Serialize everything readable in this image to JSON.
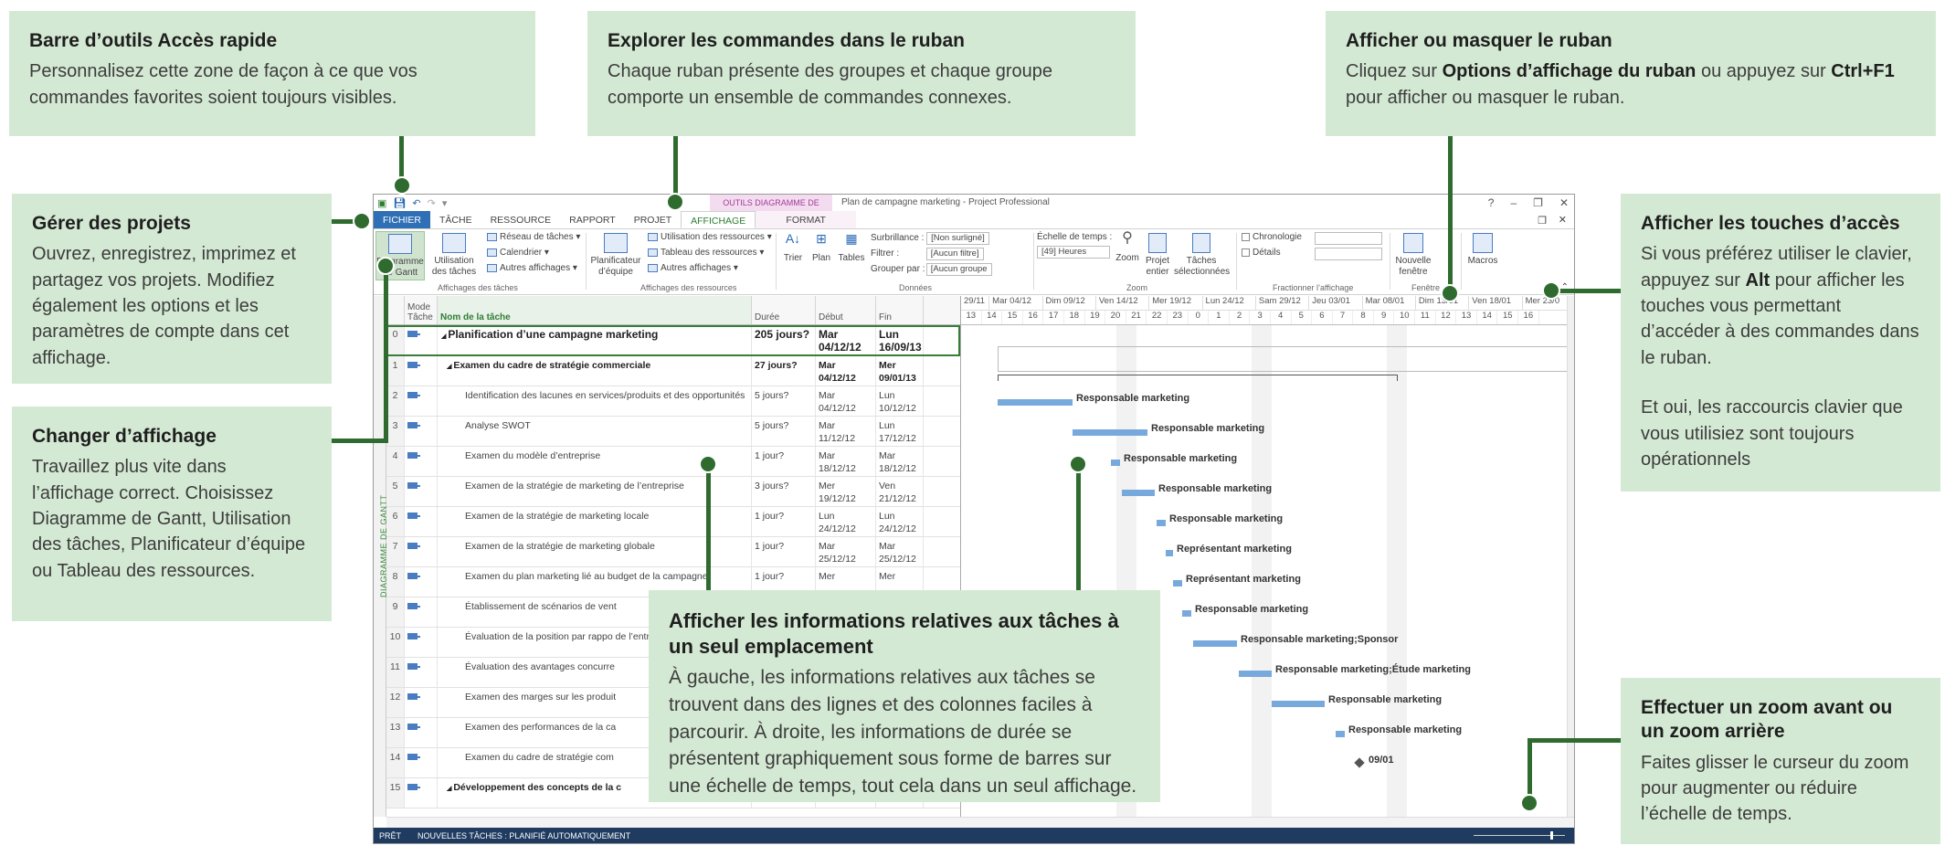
{
  "callouts": {
    "qat": {
      "title": "Barre d’outils Accès rapide",
      "body": "Personnalisez cette zone de façon à ce que vos commandes favorites soient toujours visibles."
    },
    "ribbon": {
      "title": "Explorer les commandes dans le ruban",
      "body": "Chaque ruban présente des groupes et chaque groupe comporte un ensemble de commandes connexes."
    },
    "toggle": {
      "title": "Afficher ou masquer le ruban",
      "body_pre": "Cliquez sur ",
      "body_b1": "Options d’affichage du ruban",
      "body_mid": " ou appuyez sur ",
      "body_b2": "Ctrl+F1",
      "body_post": " pour afficher ou masquer le ruban."
    },
    "manage": {
      "title": "Gérer des projets",
      "body": "Ouvrez, enregistrez, imprimez et partagez vos projets. Modifiez également les options et les paramètres de compte dans cet affichage."
    },
    "views": {
      "title": "Changer d’affichage",
      "body": "Travaillez plus vite dans l’affichage correct. Choisissez Diagramme de Gantt, Utilisation des tâches, Planificateur d’équipe ou Tableau des ressources."
    },
    "keys": {
      "title": "Afficher les touches d’accès",
      "body_pre": "Si vous préférez utiliser le clavier, appuyez sur ",
      "body_b": "Alt",
      "body_post": " pour afficher les touches vous permettant d’accéder à des commandes dans le ruban.",
      "body2": "Et oui, les raccourcis clavier que vous utilisiez sont toujours opérationnels"
    },
    "info": {
      "title": "Afficher les informations relatives aux tâches à un seul emplacement",
      "body": "À gauche, les informations relatives aux tâches se trouvent dans des lignes et des colonnes faciles à parcourir. À droite, les informations de durée se présentent graphiquement sous forme de barres sur une échelle de temps, tout cela dans un seul affichage."
    },
    "zoom": {
      "title": "Effectuer un zoom avant ou un zoom arrière",
      "body": "Faites glisser le curseur du zoom pour augmenter ou réduire l’échelle de temps."
    }
  },
  "app": {
    "context_tab_title": "OUTILS DIAGRAMME DE GANTT",
    "window_title": "Plan de campagne marketing - Project Professional",
    "tabs": [
      "FICHIER",
      "TÂCHE",
      "RESSOURCE",
      "RAPPORT",
      "PROJET",
      "AFFICHAGE",
      "FORMAT"
    ],
    "ribbon": {
      "gantt_btn": "Diagramme de Gantt",
      "task_usage_btn": "Utilisation des tâches",
      "network": "Réseau de tâches",
      "calendar": "Calendrier",
      "other_views": "Autres affichages",
      "group_task_views": "Affichages des tâches",
      "team_planner": "Planificateur d’équipe",
      "resource_usage": "Utilisation des ressources",
      "resource_sheet": "Tableau des ressources",
      "other_views2": "Autres affichages",
      "group_resource_views": "Affichages des ressources",
      "sort": "Trier",
      "outline": "Plan",
      "tables": "Tables",
      "highlight_label": "Surbrillance :",
      "highlight_val": "[Non surligné]",
      "filter_label": "Filtrer :",
      "filter_val": "[Aucun filtre]",
      "group_label": "Grouper par :",
      "group_val": "[Aucun groupe",
      "group_data": "Données",
      "timescale_label": "Échelle de temps :",
      "timescale_val": "[49] Heures",
      "zoom": "Zoom",
      "entire_project": "Projet entier",
      "selected_tasks": "Tâches sélectionnées",
      "group_zoom": "Zoom",
      "timeline": "Chronologie",
      "details": "Détails",
      "group_split": "Fractionner l’affichage",
      "new_window": "Nouvelle fenêtre",
      "group_window": "Fenêtre",
      "macros": "Macros"
    },
    "side_label": "DIAGRAMME DE GANTT",
    "columns": {
      "mode": "Mode Tâche",
      "name": "Nom de la tâche",
      "duration": "Durée",
      "start": "Début",
      "end": "Fin"
    },
    "rows": [
      {
        "id": "0",
        "name": "Planification d’une campagne marketing",
        "dur": "205 jours?",
        "start": "Mar 04/12/12",
        "end": "Lun 16/09/13",
        "level": 0,
        "sum": true
      },
      {
        "id": "1",
        "name": "Examen du cadre de stratégie commerciale",
        "dur": "27 jours?",
        "start": "Mar 04/12/12",
        "end": "Mer 09/01/13",
        "level": 1,
        "sum": true
      },
      {
        "id": "2",
        "name": "Identification des lacunes en services/produits et des opportunités",
        "dur": "5 jours?",
        "start": "Mar 04/12/12",
        "end": "Lun 10/12/12",
        "level": 2
      },
      {
        "id": "3",
        "name": "Analyse SWOT",
        "dur": "5 jours?",
        "start": "Mar 11/12/12",
        "end": "Lun 17/12/12",
        "level": 2
      },
      {
        "id": "4",
        "name": "Examen du modèle d’entreprise",
        "dur": "1 jour?",
        "start": "Mar 18/12/12",
        "end": "Mar 18/12/12",
        "level": 2
      },
      {
        "id": "5",
        "name": "Examen de la stratégie de marketing de l’entreprise",
        "dur": "3 jours?",
        "start": "Mer 19/12/12",
        "end": "Ven 21/12/12",
        "level": 2
      },
      {
        "id": "6",
        "name": "Examen de la stratégie de marketing locale",
        "dur": "1 jour?",
        "start": "Lun 24/12/12",
        "end": "Lun 24/12/12",
        "level": 2
      },
      {
        "id": "7",
        "name": "Examen de la stratégie de marketing globale",
        "dur": "1 jour?",
        "start": "Mar 25/12/12",
        "end": "Mar 25/12/12",
        "level": 2
      },
      {
        "id": "8",
        "name": "Examen du plan marketing lié au budget de la campagne",
        "dur": "1 jour?",
        "start": "Mer",
        "end": "Mer",
        "level": 2
      },
      {
        "id": "9",
        "name": "Établissement de scénarios de vent",
        "dur": "",
        "start": "",
        "end": "",
        "level": 2
      },
      {
        "id": "10",
        "name": "Évaluation de la position par rappo de l’entreprise",
        "dur": "",
        "start": "",
        "end": "",
        "level": 2
      },
      {
        "id": "11",
        "name": "Évaluation des avantages concurre",
        "dur": "",
        "start": "",
        "end": "",
        "level": 2
      },
      {
        "id": "12",
        "name": "Examen des marges sur les produit",
        "dur": "",
        "start": "",
        "end": "",
        "level": 2
      },
      {
        "id": "13",
        "name": "Examen des performances de la ca",
        "dur": "",
        "start": "",
        "end": "",
        "level": 2
      },
      {
        "id": "14",
        "name": "Examen du cadre de stratégie com",
        "dur": "",
        "start": "",
        "end": "",
        "level": 2
      },
      {
        "id": "15",
        "name": "Développement des concepts de la c",
        "dur": "",
        "start": "",
        "end": "",
        "level": 1,
        "sum": true
      }
    ],
    "timescale_top": [
      "29/11",
      "Mar 04/12",
      "Dim 09/12",
      "Ven 14/12",
      "Mer 19/12",
      "Lun 24/12",
      "Sam 29/12",
      "Jeu 03/01",
      "Mar 08/01",
      "Dim 13/01",
      "Ven 18/01",
      "Mer 23/0"
    ],
    "timescale_bottom": [
      "13",
      "14",
      "15",
      "16",
      "17",
      "18",
      "19",
      "20",
      "21",
      "22",
      "23",
      "0",
      "1",
      "2",
      "3",
      "4",
      "5",
      "6",
      "7",
      "8",
      "9",
      "10",
      "11",
      "12",
      "13",
      "14",
      "15",
      "16"
    ],
    "gantt_labels": [
      "Responsable marketing",
      "Responsable marketing",
      "Responsable marketing",
      "Responsable marketing",
      "Responsable marketing",
      "Représentant marketing",
      "Représentant marketing",
      "Responsable marketing",
      "Responsable marketing;Sponsor",
      "Responsable marketing;Étude marketing",
      "Responsable marketing",
      "Responsable marketing",
      "09/01"
    ],
    "status": {
      "ready": "PRÊT",
      "new_tasks": "NOUVELLES TÂCHES : PLANIFIÉ AUTOMATIQUEMENT"
    },
    "colors": {
      "accent": "#2e7d32",
      "callout_bg": "#d4e9d4",
      "connector": "#2f6b2f",
      "bar": "#78a9dc"
    }
  }
}
